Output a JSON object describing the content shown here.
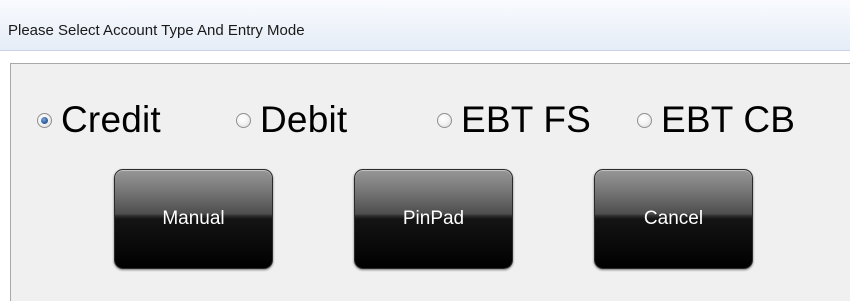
{
  "window": {
    "title": "Please Select Account Type And Entry Mode"
  },
  "account_types": [
    {
      "label": "Credit",
      "selected": true
    },
    {
      "label": "Debit",
      "selected": false
    },
    {
      "label": "EBT FS",
      "selected": false
    },
    {
      "label": "EBT CB",
      "selected": false
    }
  ],
  "entry_modes": {
    "manual_label": "Manual",
    "pinpad_label": "PinPad",
    "cancel_label": "Cancel"
  },
  "colors": {
    "titlebar": "#eef3fa",
    "panel": "#f0f0f0",
    "button": "#1a1a1a",
    "button_text": "#ffffff",
    "radio_selected": "#2c5e9e"
  }
}
